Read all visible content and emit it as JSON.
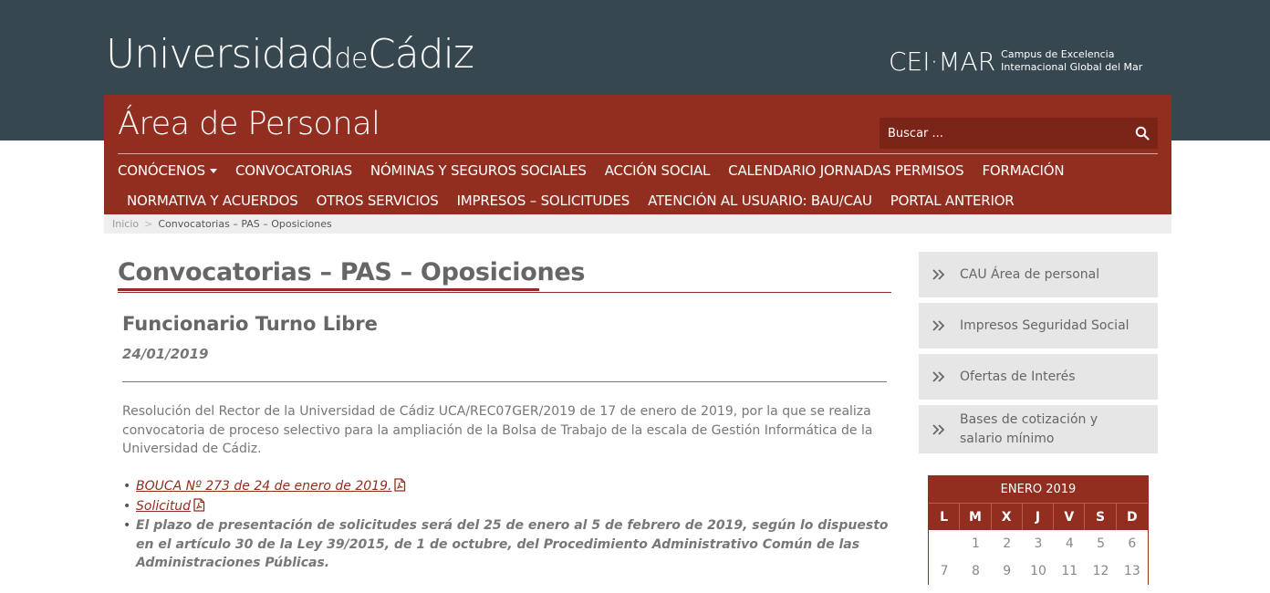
{
  "header": {
    "logo_big1": "Universidad",
    "logo_small": "de",
    "logo_big2": "Cádiz",
    "cei_mark": "CEI·MAR",
    "cei_line1": "Campus de Excelencia",
    "cei_line2": "Internacional Global del Mar"
  },
  "site": {
    "area_title": "Área de Personal",
    "search_placeholder": "Buscar ..."
  },
  "nav": {
    "row1": [
      "CONÓCENOS",
      "CONVOCATORIAS",
      "NÓMINAS Y SEGUROS SOCIALES",
      "ACCIÓN SOCIAL",
      "CALENDARIO JORNADAS PERMISOS",
      "FORMACIÓN"
    ],
    "row2": [
      "NORMATIVA Y ACUERDOS",
      "OTROS SERVICIOS",
      "IMPRESOS – SOLICITUDES",
      "ATENCIÓN AL USUARIO: BAU/CAU",
      "PORTAL ANTERIOR"
    ]
  },
  "breadcrumb": {
    "home": "Inicio",
    "sep": ">",
    "current": "Convocatorias – PAS – Oposiciones"
  },
  "main": {
    "page_title": "Convocatorias – PAS – Oposiciones",
    "post_title": "Funcionario Turno Libre",
    "post_date": "24/01/2019",
    "post_body": "Resolución del Rector de la Universidad de Cádiz UCA/REC07GER/2019 de 17 de enero de 2019, por la que se realiza convocatoria de proceso selectivo para la ampliación de la Bolsa de Trabajo de la escala de Gestión Informática de la Universidad de Cádiz.",
    "links": {
      "bouca": "BOUCA Nº 273 de 24 de enero de 2019.",
      "solicitud": "Solicitud"
    },
    "plazo": "El plazo de presentación de solicitudes será del 25 de enero al 5 de febrero de  2019, según lo dispuesto en el artículo 30 de la Ley 39/2015, de 1 de octubre, del Procedimiento Administrativo Común de las Administraciones Públicas."
  },
  "sidebar": {
    "items": [
      "CAU Área de personal",
      "Impresos Seguridad Social",
      "Ofertas de Interés",
      "Bases de cotización y salario mínimo"
    ]
  },
  "calendar": {
    "month": "ENERO 2019",
    "days_of_week": [
      "L",
      "M",
      "X",
      "J",
      "V",
      "S",
      "D"
    ],
    "row1": [
      "",
      "1",
      "2",
      "3",
      "4",
      "5",
      "6"
    ],
    "row2": [
      "7",
      "8",
      "9",
      "10",
      "11",
      "12",
      "13"
    ]
  },
  "colors": {
    "header_bg": "#37474f",
    "brand_red": "#922e1f",
    "search_bg": "#7a2417",
    "sidebar_bg": "#e6e6e6"
  },
  "icons": {
    "search": "search-icon",
    "pdf": "pdf-icon",
    "sidebar": "double-chevron-right-icon",
    "dropdown": "caret-down-icon"
  }
}
